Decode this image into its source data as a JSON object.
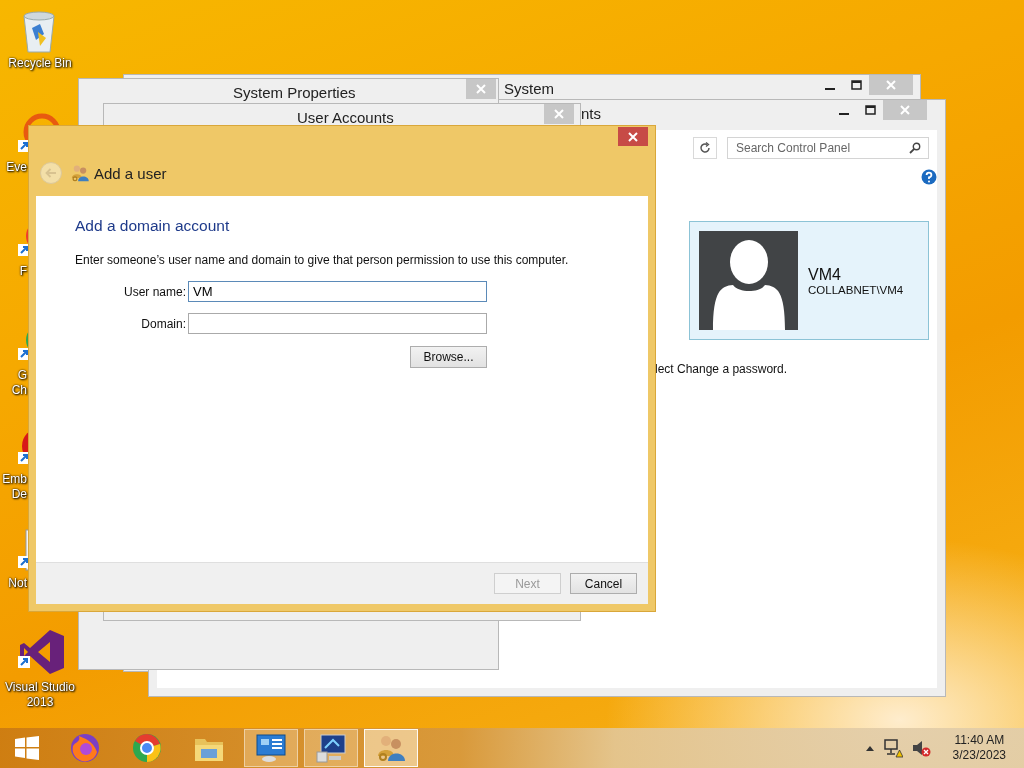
{
  "desktop_icons": [
    {
      "kind": "bin",
      "lines": [
        "Recycle Bin"
      ],
      "cut": false
    },
    {
      "kind": "ring",
      "lines": [
        "Eve"
      ],
      "cut": true
    },
    {
      "kind": "flame",
      "lines": [
        "F"
      ],
      "cut": true
    },
    {
      "kind": "chrome",
      "lines": [
        "G",
        "Ch"
      ],
      "cut": true
    },
    {
      "kind": "pdf",
      "lines": [
        "Emb",
        "De"
      ],
      "cut": true
    },
    {
      "kind": "notepad",
      "lines": [
        "Not"
      ],
      "cut": true
    },
    {
      "kind": "vs",
      "lines": [
        "Visual Studio",
        "2013"
      ],
      "cut": false
    }
  ],
  "system_window": {
    "title": "System"
  },
  "control_panel": {
    "title": "nts",
    "search": {
      "placeholder": "Search Control Panel"
    },
    "account": {
      "name": "VM4",
      "domain": "COLLABNET\\VM4"
    },
    "instruction": "lect Change a password."
  },
  "system_properties": {
    "title": "System Properties"
  },
  "user_accounts": {
    "title": "User Accounts"
  },
  "add_user": {
    "nav_title": "Add a user",
    "back_disabled": true,
    "heading": "Add a domain account",
    "description": "Enter someone’s user name and domain to give that person permission to use this computer.",
    "fields": [
      {
        "label": "User name:",
        "value": "VM",
        "focused": true
      },
      {
        "label": "Domain:",
        "focused": false
      }
    ],
    "browse": "Browse...",
    "buttons": [
      {
        "label": "Next",
        "disabled": true
      },
      {
        "label": "Cancel",
        "disabled": false
      }
    ]
  },
  "taskbar": {
    "pinned": [
      {
        "kind": "firefox"
      },
      {
        "kind": "chrome"
      },
      {
        "kind": "folder"
      }
    ],
    "tasks": [
      {
        "kind": "control-panel",
        "selected": false
      },
      {
        "kind": "monitor",
        "selected": false
      },
      {
        "kind": "users",
        "selected": true
      }
    ],
    "time": "11:40 AM",
    "date": "3/23/2023"
  }
}
